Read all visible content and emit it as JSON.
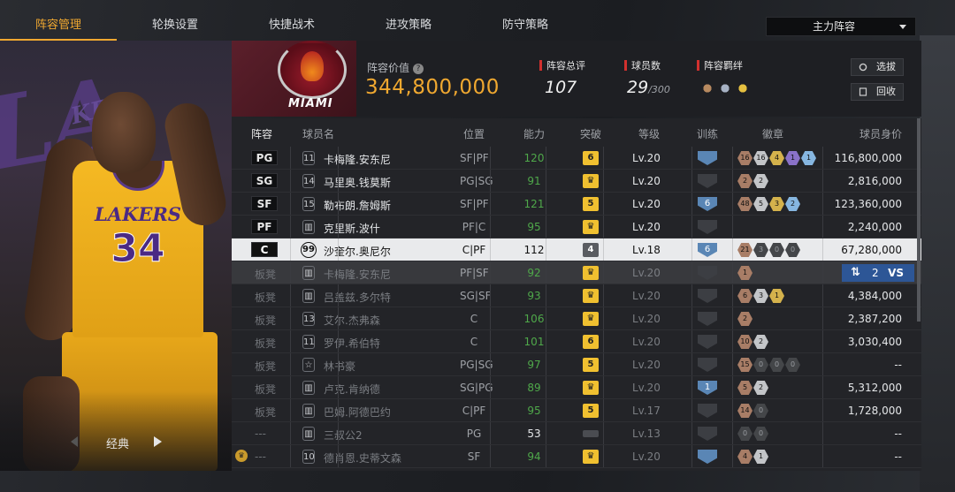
{
  "tabs": [
    "阵容管理",
    "轮换设置",
    "快捷战术",
    "进攻策略",
    "防守策略"
  ],
  "active_tab": "阵容管理",
  "lineup_select": "主力阵容",
  "player_card": {
    "team_word": "LAKERS",
    "jersey_number": "34",
    "style_label": "经典"
  },
  "header": {
    "team_logo_text": "MIAMI",
    "value_label": "阵容价值",
    "value": "344,800,000",
    "rating_label": "阵容总评",
    "rating": "107",
    "players_label": "球员数",
    "players": "29",
    "players_max": "/300",
    "synergy_label": "阵容羁绊",
    "btn_select": "选拔",
    "btn_recycle": "回收"
  },
  "columns": [
    "阵容",
    "球员名",
    "位置",
    "能力",
    "突破",
    "等级",
    "训练",
    "徽章",
    "球员身价"
  ],
  "rows": [
    {
      "slot": "PG",
      "num": "11",
      "name": "卡梅隆.安东尼",
      "pos": "SF|PF",
      "ovr": "120",
      "brk": "6",
      "lv": "Lv.20",
      "tr": "",
      "badges": [
        [
          "b",
          "16"
        ],
        [
          "s",
          "16"
        ],
        [
          "g",
          "4"
        ],
        [
          "a",
          "1"
        ],
        [
          "h",
          "1"
        ]
      ],
      "price": "116,800,000"
    },
    {
      "slot": "SG",
      "num": "14",
      "name": "马里奥.钱莫斯",
      "pos": "PG|SG",
      "ovr": "91",
      "brk": "♛",
      "lv": "Lv.20",
      "tr": "",
      "badges": [
        [
          "b",
          "2"
        ],
        [
          "s",
          "2"
        ]
      ],
      "price": "2,816,000"
    },
    {
      "slot": "SF",
      "num": "15",
      "name": "勒布朗.詹姆斯",
      "pos": "SF|PF",
      "ovr": "121",
      "brk": "5",
      "lv": "Lv.20",
      "tr": "6",
      "badges": [
        [
          "b",
          "48"
        ],
        [
          "s",
          "5"
        ],
        [
          "g",
          "3"
        ],
        [
          "h",
          "2"
        ]
      ],
      "price": "123,360,000"
    },
    {
      "slot": "PF",
      "num": "",
      "name": "克里斯.波什",
      "pos": "PF|C",
      "ovr": "95",
      "brk": "♛",
      "lv": "Lv.20",
      "tr": "",
      "badges": [],
      "price": "2,240,000"
    },
    {
      "slot": "C",
      "num": "99",
      "name": "沙奎尔.奥尼尔",
      "pos": "C|PF",
      "ovr": "112",
      "brk": "4",
      "lv": "Lv.18",
      "tr": "6",
      "badges": [
        [
          "b",
          "21"
        ],
        [
          "n",
          "3"
        ],
        [
          "n",
          "0"
        ],
        [
          "n",
          "0"
        ]
      ],
      "price": "67,280,000"
    },
    {
      "slot": "板凳",
      "num": "",
      "name": "卡梅隆.安东尼",
      "pos": "PF|SF",
      "ovr": "92",
      "brk": "♛",
      "lv": "Lv.20",
      "tr": "",
      "badges": [
        [
          "b",
          "1"
        ]
      ],
      "price": "2"
    },
    {
      "slot": "板凳",
      "num": "",
      "name": "吕盖兹.多尔特",
      "pos": "SG|SF",
      "ovr": "93",
      "brk": "♛",
      "lv": "Lv.20",
      "tr": "",
      "badges": [
        [
          "b",
          "6"
        ],
        [
          "s",
          "3"
        ],
        [
          "g",
          "1"
        ]
      ],
      "price": "4,384,000"
    },
    {
      "slot": "板凳",
      "num": "13",
      "name": "艾尔.杰弗森",
      "pos": "C",
      "ovr": "106",
      "brk": "♛",
      "lv": "Lv.20",
      "tr": "",
      "badges": [
        [
          "b",
          "2"
        ]
      ],
      "price": "2,387,200"
    },
    {
      "slot": "板凳",
      "num": "11",
      "name": "罗伊.希伯特",
      "pos": "C",
      "ovr": "101",
      "brk": "6",
      "lv": "Lv.20",
      "tr": "",
      "badges": [
        [
          "b",
          "10"
        ],
        [
          "s",
          "2"
        ]
      ],
      "price": "3,030,400"
    },
    {
      "slot": "板凳",
      "num": "☆",
      "name": "林书豪",
      "pos": "PG|SG",
      "ovr": "97",
      "brk": "5",
      "lv": "Lv.20",
      "tr": "",
      "badges": [
        [
          "b",
          "15"
        ],
        [
          "n",
          "0"
        ],
        [
          "n",
          "0"
        ],
        [
          "n",
          "0"
        ]
      ],
      "price": "--"
    },
    {
      "slot": "板凳",
      "num": "",
      "name": "卢克.肯纳德",
      "pos": "SG|PG",
      "ovr": "89",
      "brk": "♛",
      "lv": "Lv.20",
      "tr": "1",
      "badges": [
        [
          "b",
          "5"
        ],
        [
          "s",
          "2"
        ]
      ],
      "price": "5,312,000"
    },
    {
      "slot": "板凳",
      "num": "",
      "name": "巴姆.阿德巴约",
      "pos": "C|PF",
      "ovr": "95",
      "brk": "5",
      "lv": "Lv.17",
      "tr": "",
      "badges": [
        [
          "b",
          "14"
        ],
        [
          "n",
          "0"
        ]
      ],
      "price": "1,728,000"
    },
    {
      "slot": "---",
      "num": "",
      "name": "三叔公2",
      "pos": "PG",
      "ovr": "53",
      "brk": "",
      "lv": "Lv.13",
      "tr": "",
      "badges": [
        [
          "n",
          "0"
        ],
        [
          "n",
          "0"
        ]
      ],
      "price": "--"
    },
    {
      "slot": "---",
      "num": "10",
      "name": "德肖恩.史蒂文森",
      "pos": "SF",
      "ovr": "94",
      "brk": "♛",
      "lv": "Lv.20",
      "tr": "",
      "badges": [
        [
          "b",
          "4"
        ],
        [
          "s",
          "1"
        ]
      ],
      "price": "--"
    }
  ],
  "vs_label": "VS",
  "colors": {
    "accent": "#f0a830",
    "ovr_green": "#4fa84a",
    "vs_blue": "#2d5696"
  }
}
